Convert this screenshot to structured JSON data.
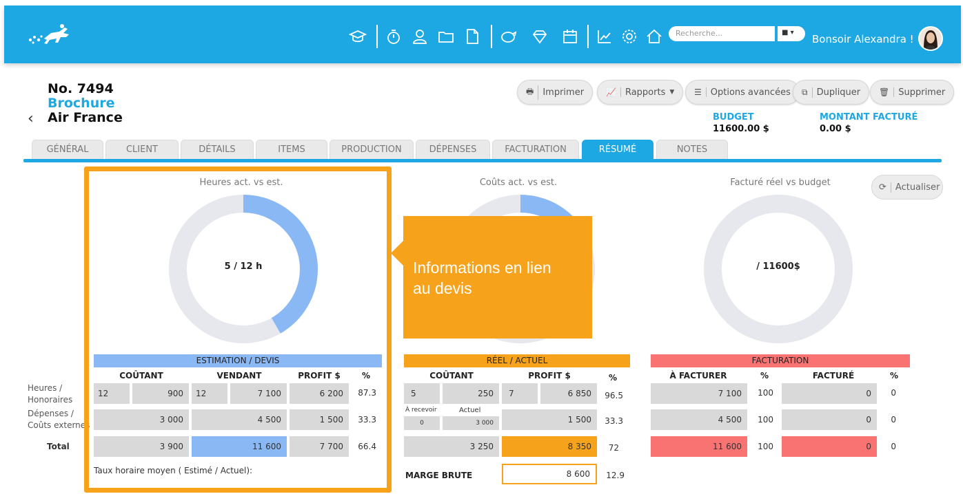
{
  "header": {
    "search_placeholder": "Recherche...",
    "greeting": "Bonsoir Alexandra !",
    "nav_icons": [
      "graduation-cap-icon",
      "stopwatch-icon",
      "user-icon",
      "folder-icon",
      "document-icon",
      "piggy-bank-icon",
      "diamond-icon",
      "calendar-icon",
      "chart-icon",
      "gear-icon",
      "home-icon"
    ]
  },
  "project": {
    "number": "No. 7494",
    "type": "Brochure",
    "client": "Air France"
  },
  "toolbar": {
    "print": "Imprimer",
    "reports": "Rapports",
    "advanced": "Options avancées",
    "duplicate": "Dupliquer",
    "delete": "Supprimer"
  },
  "summary": {
    "budget_label": "BUDGET",
    "budget_value": "11600.00 $",
    "billed_label": "MONTANT FACTURÉ",
    "billed_value": "0.00 $"
  },
  "tabs": [
    "GÉNÉRAL",
    "CLIENT",
    "DÉTAILS",
    "ITEMS",
    "PRODUCTION",
    "DÉPENSES",
    "FACTURATION",
    "RÉSUMÉ",
    "NOTES"
  ],
  "active_tab": "RÉSUMÉ",
  "refresh_label": "Actualiser",
  "charts": {
    "hours": {
      "title": "Heures act. vs est.",
      "label": "5 / 12 h",
      "actual": 5,
      "estimate": 12
    },
    "costs": {
      "title": "Coûts act. vs est."
    },
    "billing": {
      "title": "Facturé réel vs budget",
      "label": "/ 11600$"
    }
  },
  "colors": {
    "blue": "#1da7e3",
    "light_blue": "#8ab8f5",
    "orange": "#f7a21b",
    "red": "#f87372",
    "gray": "#d9d9d9"
  },
  "callout": {
    "line1": "Informations en lien",
    "line2": "au devis"
  },
  "estimation": {
    "title": "ESTIMATION / DEVIS",
    "headers": [
      "COÛTANT",
      "VENDANT",
      "PROFIT $",
      "%"
    ],
    "row_labels": [
      [
        "Heures /",
        "Honoraires"
      ],
      [
        "Dépenses /",
        "Coûts externes"
      ],
      [
        "Total"
      ]
    ],
    "hours": [
      "12",
      "900",
      "12",
      "7 100",
      "6 200",
      "87.3"
    ],
    "expenses": [
      "3 000",
      "4 500",
      "1 500",
      "33.3"
    ],
    "total": [
      "3 900",
      "11 600",
      "7 700",
      "66.4"
    ],
    "hourly_rate": "Taux horaire moyen ( Estimé / Actuel):"
  },
  "actual": {
    "title": "RÉEL / ACTUEL",
    "headers": [
      "COÛTANT",
      "PROFIT $",
      "%"
    ],
    "hours": [
      "5",
      "250",
      "7",
      "6 850",
      "96.5"
    ],
    "expenses_sub": [
      "À recevoir",
      "Actuel"
    ],
    "expenses_small": [
      "0",
      "3 000"
    ],
    "expenses": [
      "1 500",
      "33.3"
    ],
    "total": [
      "3 250",
      "8 350",
      "72"
    ],
    "margin_label": "MARGE BRUTE",
    "margin_value": "8 600",
    "margin_pct": "12.9"
  },
  "billing": {
    "title": "FACTURATION",
    "headers": [
      "À FACTURER",
      "%",
      "FACTURÉ",
      "%"
    ],
    "hours": [
      "7 100",
      "100",
      "0",
      "0"
    ],
    "expenses": [
      "4 500",
      "100",
      "0",
      "0"
    ],
    "total": [
      "11 600",
      "100",
      "0",
      "0"
    ]
  }
}
